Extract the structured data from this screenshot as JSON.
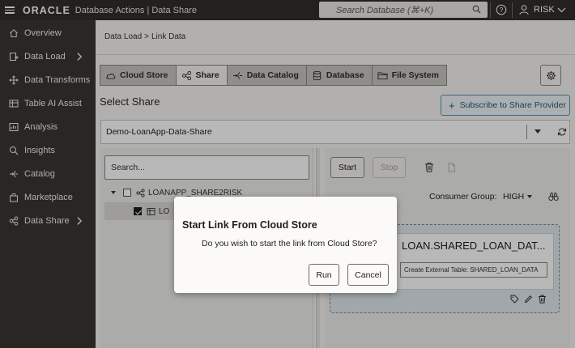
{
  "topbar": {
    "brand": "ORACLE",
    "app_title": "Database Actions | Data Share",
    "search_placeholder": "Search Database (⌘+K)",
    "user": "RISK"
  },
  "sidebar": {
    "items": [
      {
        "label": "Overview",
        "icon": "home-icon"
      },
      {
        "label": "Data Load",
        "icon": "data-load-icon",
        "has_submenu": true
      },
      {
        "label": "Data Transforms",
        "icon": "transforms-icon"
      },
      {
        "label": "Table AI Assist",
        "icon": "table-ai-icon"
      },
      {
        "label": "Analysis",
        "icon": "analysis-icon"
      },
      {
        "label": "Insights",
        "icon": "insights-icon"
      },
      {
        "label": "Catalog",
        "icon": "catalog-icon"
      },
      {
        "label": "Marketplace",
        "icon": "marketplace-icon"
      },
      {
        "label": "Data Share",
        "icon": "data-share-icon",
        "has_submenu": true
      }
    ]
  },
  "breadcrumb": {
    "parent": "Data Load",
    "separator": ">",
    "current": "Link Data"
  },
  "tabs": [
    {
      "label": "Cloud Store",
      "icon": "cloud-icon",
      "active": false
    },
    {
      "label": "Share",
      "icon": "share-icon",
      "active": true
    },
    {
      "label": "Data Catalog",
      "icon": "data-catalog-icon",
      "active": false
    },
    {
      "label": "Database",
      "icon": "database-icon",
      "active": false
    },
    {
      "label": "File System",
      "icon": "folder-icon",
      "active": false
    }
  ],
  "select_share": {
    "title": "Select Share",
    "subscribe_label": "Subscribe to Share Provider",
    "selected_share": "Demo-LoanApp-Data-Share"
  },
  "left_panel": {
    "search_placeholder": "Search...",
    "tree": [
      {
        "label": "LOANAPP_SHARE2RISK",
        "checked": false
      },
      {
        "label": "LO",
        "checked": true
      }
    ]
  },
  "right_panel": {
    "start_label": "Start",
    "stop_label": "Stop",
    "consumer_group_label": "Consumer Group:",
    "consumer_group_value": "HIGH",
    "card_title": "LOAN.SHARED_LOAN_DAT...",
    "card_note": "Create External Table: SHARED_LOAN_DATA"
  },
  "dialog": {
    "title": "Start Link From Cloud Store",
    "message": "Do you wish to start the link from Cloud Store?",
    "run_label": "Run",
    "cancel_label": "Cancel"
  },
  "colors": {
    "topbar_bg": "#312d2a",
    "sidebar_bg": "#3a3631",
    "accent": "#1c5b7a"
  }
}
